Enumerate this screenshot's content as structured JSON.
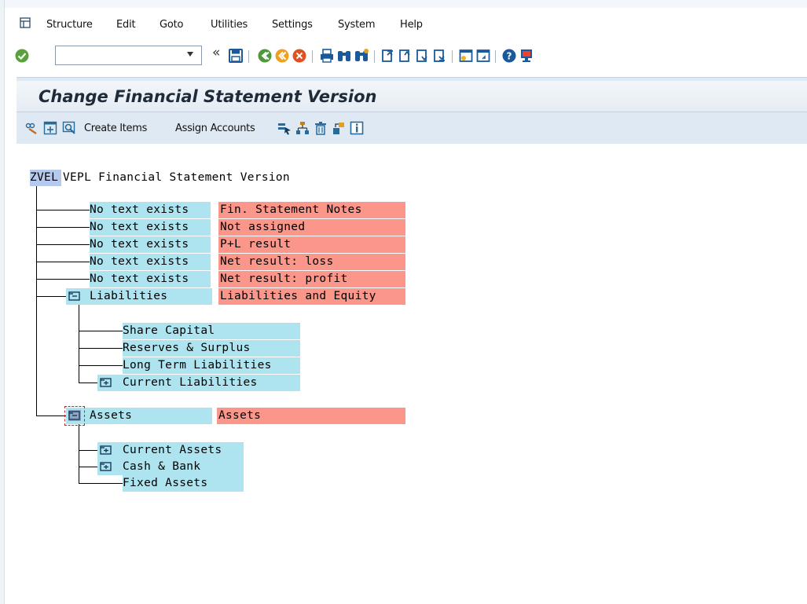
{
  "menu": {
    "items": [
      "Structure",
      "Edit",
      "Goto",
      "Utilities",
      "Settings",
      "System",
      "Help"
    ]
  },
  "toolbar": {
    "command_value": "",
    "back_label": "«"
  },
  "title": "Change Financial Statement Version",
  "app_toolbar": {
    "create_items": "Create Items",
    "assign_accounts": "Assign Accounts"
  },
  "tree": {
    "root_key": "ZVEL",
    "root_text": "VEPL Financial Statement Version",
    "top_items": [
      {
        "label": "No text exists",
        "desc": "Fin. Statement Notes"
      },
      {
        "label": "No text exists",
        "desc": "Not assigned"
      },
      {
        "label": "No text exists",
        "desc": "P+L result"
      },
      {
        "label": "No text exists",
        "desc": "Net result: loss"
      },
      {
        "label": "No text exists",
        "desc": "Net result: profit"
      }
    ],
    "liabilities": {
      "label": "Liabilities",
      "desc": "Liabilities and Equity",
      "children": [
        "Share Capital",
        "Reserves & Surplus",
        "Long Term Liabilities",
        "Current Liabilities"
      ]
    },
    "assets": {
      "label": "Assets",
      "desc": "Assets",
      "children": [
        "Current Assets",
        "Cash & Bank",
        "Fixed Assets"
      ]
    }
  },
  "colors": {
    "node_blue": "#aee4f0",
    "desc_red": "#fa968a",
    "root_highlight": "#b5c8ee",
    "title_bg": "#dfe9f3"
  },
  "icons": {
    "menu": "menu-open-icon",
    "ok": "green-check-icon",
    "save": "save-icon",
    "back": "back-icon",
    "exit": "exit-icon",
    "cancel": "cancel-icon",
    "print": "print-icon",
    "find": "find-icon",
    "find_next": "find-next-icon",
    "first_page": "first-page-icon",
    "prev_page": "previous-page-icon",
    "next_page": "next-page-icon",
    "last_page": "last-page-icon",
    "new_session": "new-session-icon",
    "shortcut": "shortcut-icon",
    "help": "help-icon",
    "layout": "customize-layout-icon"
  }
}
